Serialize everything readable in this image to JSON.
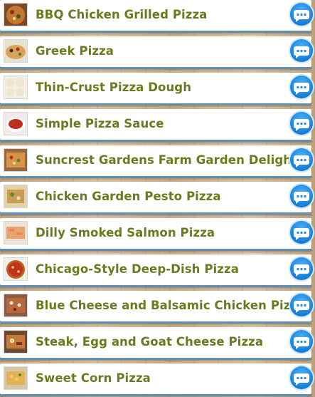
{
  "recipes": [
    {
      "title": "BBQ Chicken Grilled Pizza",
      "thumb_icon": "pizza-photo-icon"
    },
    {
      "title": "Greek Pizza",
      "thumb_icon": "pizza-photo-icon"
    },
    {
      "title": "Thin-Crust Pizza Dough",
      "thumb_icon": "dough-photo-icon"
    },
    {
      "title": "Simple Pizza Sauce",
      "thumb_icon": "sauce-photo-icon"
    },
    {
      "title": "Suncrest Gardens Farm Garden Delight",
      "thumb_icon": "pizza-photo-icon"
    },
    {
      "title": "Chicken Garden Pesto Pizza",
      "thumb_icon": "pizza-photo-icon"
    },
    {
      "title": "Dilly Smoked Salmon Pizza",
      "thumb_icon": "pizza-photo-icon"
    },
    {
      "title": "Chicago-Style Deep-Dish Pizza",
      "thumb_icon": "pizza-photo-icon"
    },
    {
      "title": "Blue Cheese and Balsamic Chicken Pizza",
      "thumb_icon": "pizza-photo-icon"
    },
    {
      "title": "Steak, Egg and Goat Cheese Pizza",
      "thumb_icon": "pizza-photo-icon"
    },
    {
      "title": "Sweet Corn Pizza",
      "thumb_icon": "pizza-photo-icon"
    }
  ],
  "action_icon": "chat-bubble-icon",
  "colors": {
    "title_text": "#6b7a1f",
    "row_background": "#ffffff",
    "row_accent": "#5f8fb3",
    "button": "#1c86e0"
  }
}
